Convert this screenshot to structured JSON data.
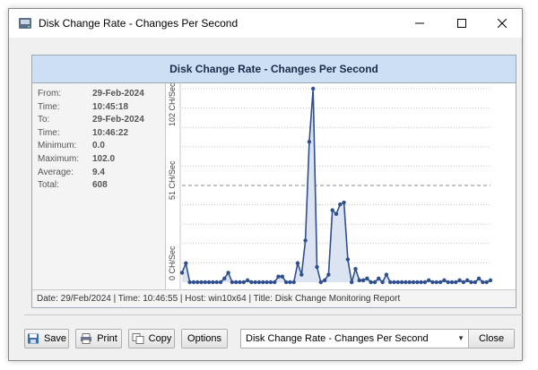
{
  "window": {
    "title": "Disk Change Rate - Changes Per Second"
  },
  "panel": {
    "header": "Disk Change Rate - Changes Per Second",
    "stats": [
      {
        "label": "From:",
        "value": "29-Feb-2024"
      },
      {
        "label": "Time:",
        "value": "10:45:18"
      },
      {
        "label": "To:",
        "value": "29-Feb-2024"
      },
      {
        "label": "Time:",
        "value": "10:46:22"
      },
      {
        "label": "Minimum:",
        "value": "0.0"
      },
      {
        "label": "Maximum:",
        "value": "102.0"
      },
      {
        "label": "Average:",
        "value": "9.4"
      },
      {
        "label": "Total:",
        "value": "608"
      }
    ],
    "footer": "Date: 29/Feb/2024 | Time: 10:46:55 | Host: win10x64 | Title: Disk Change Monitoring Report"
  },
  "chart_data": {
    "type": "area",
    "ylabel_ticks": [
      "0 CH/Sec",
      "51 CH/Sec",
      "102 CH/Sec"
    ],
    "ylim": [
      0,
      102
    ],
    "grid": true,
    "line_color": "#2f4f8f",
    "fill_color": "#dbe4f0",
    "values": [
      5,
      10,
      0,
      0,
      0,
      0,
      0,
      0,
      0,
      0,
      0,
      2,
      5,
      0,
      0,
      0,
      0,
      1,
      0,
      0,
      0,
      0,
      0,
      0,
      0,
      3,
      3,
      0,
      0,
      0,
      10,
      4,
      22,
      74,
      102,
      8,
      0,
      1,
      4,
      38,
      36,
      41,
      42,
      12,
      0,
      7,
      1,
      1,
      2,
      0,
      0,
      2,
      0,
      4,
      0,
      0,
      0,
      0,
      0,
      0,
      0,
      0,
      0,
      0,
      1,
      0,
      0,
      0,
      1,
      0,
      0,
      0,
      1,
      0,
      1,
      0,
      0,
      2,
      0,
      0,
      1
    ]
  },
  "toolbar": {
    "save_label": "Save",
    "print_label": "Print",
    "copy_label": "Copy",
    "options_label": "Options",
    "combo_value": "Disk Change Rate - Changes Per Second",
    "close_label": "Close"
  },
  "icons": {
    "save": "floppy-disk-icon",
    "print": "printer-icon",
    "copy": "copy-icon",
    "app": "disk-icon"
  }
}
